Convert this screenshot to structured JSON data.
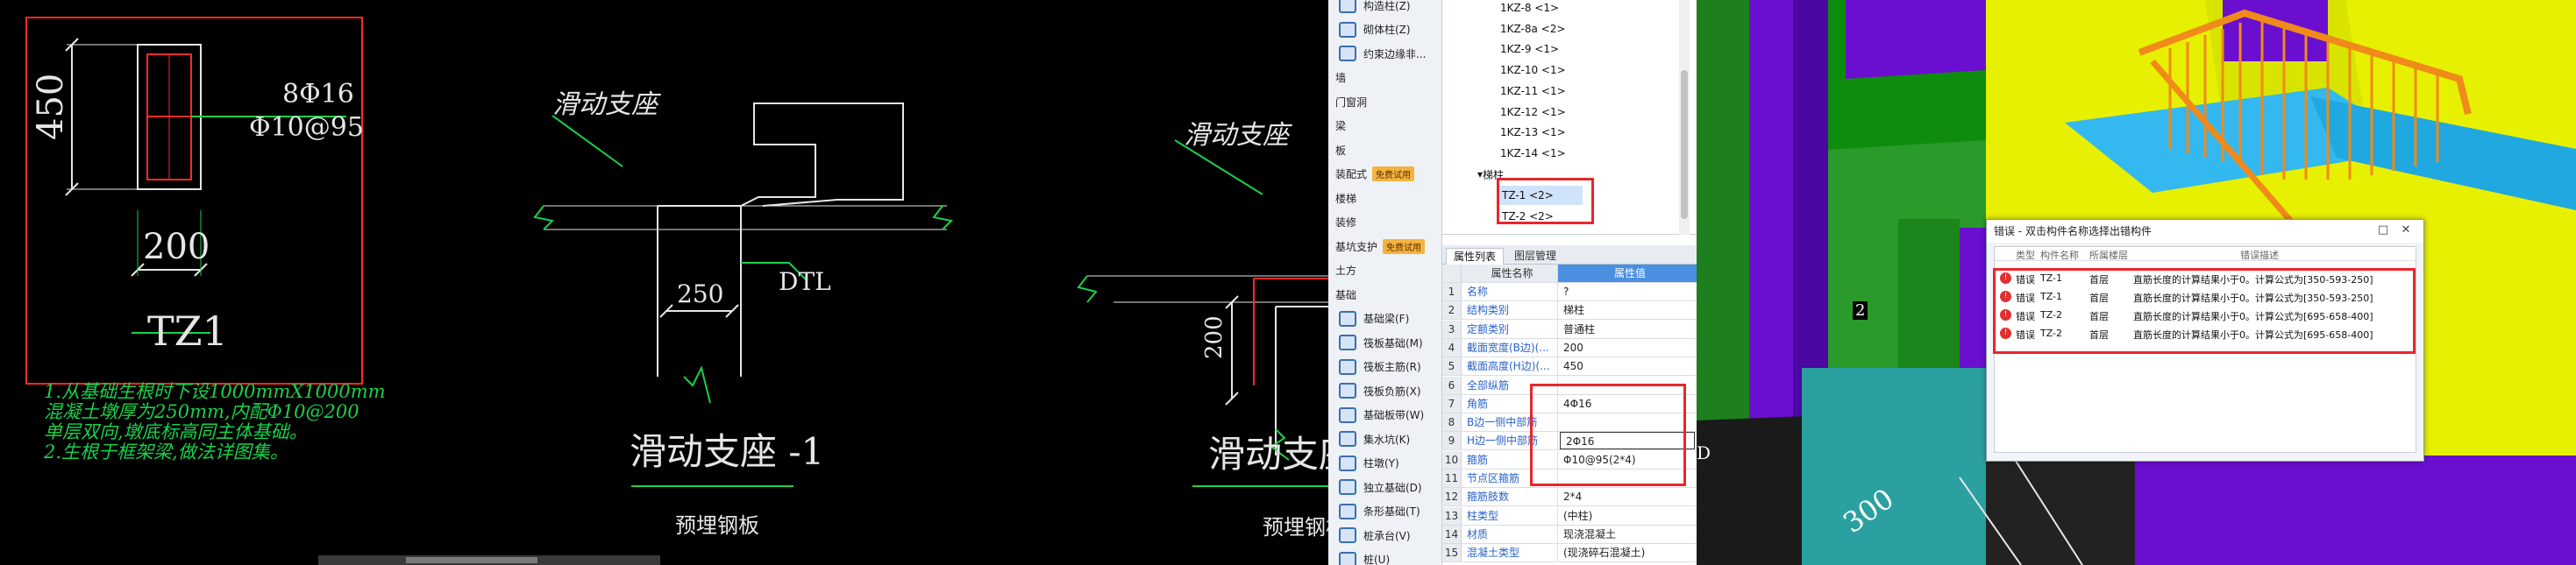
{
  "cad": {
    "tz1": {
      "height_dim": "450",
      "width_dim": "200",
      "rebar_main": "8Φ16",
      "rebar_stirrup": "Φ10@95",
      "label": "TZ1"
    },
    "notes": [
      "1.从基础生根时下设1000mmX1000mm",
      "混凝土墩厚为250mm,内配Φ10@200",
      "单层双向,墩底标高同主体基础。",
      "2.生根于框架梁,做法详图集。"
    ],
    "support1": {
      "leader": "滑动支座",
      "dim": "250",
      "dtl": "DTL",
      "title": "滑动支座  -1",
      "sub": "预埋钢板"
    },
    "support2": {
      "leader": "滑动支座",
      "dim": "200",
      "title": "滑动支座  -",
      "sub": "预埋钢板"
    }
  },
  "nav": {
    "items": [
      {
        "type": "item",
        "label": "构造柱(Z)"
      },
      {
        "type": "item",
        "label": "砌体柱(Z)"
      },
      {
        "type": "item",
        "label": "约束边缘非..."
      },
      {
        "type": "cat",
        "label": "墙"
      },
      {
        "type": "cat",
        "label": "门窗洞"
      },
      {
        "type": "cat",
        "label": "梁"
      },
      {
        "type": "cat",
        "label": "板"
      },
      {
        "type": "cat",
        "label": "装配式",
        "badge": "免费试用"
      },
      {
        "type": "cat",
        "label": "楼梯"
      },
      {
        "type": "cat",
        "label": "装修"
      },
      {
        "type": "cat",
        "label": "基坑支护",
        "badge": "免费试用"
      },
      {
        "type": "cat",
        "label": "土方"
      },
      {
        "type": "cat",
        "label": "基础"
      },
      {
        "type": "item",
        "label": "基础梁(F)"
      },
      {
        "type": "item",
        "label": "筏板基础(M)"
      },
      {
        "type": "item",
        "label": "筏板主筋(R)"
      },
      {
        "type": "item",
        "label": "筏板负筋(X)"
      },
      {
        "type": "item",
        "label": "基础板带(W)"
      },
      {
        "type": "item",
        "label": "集水坑(K)"
      },
      {
        "type": "item",
        "label": "柱墩(Y)"
      },
      {
        "type": "item",
        "label": "独立基础(D)"
      },
      {
        "type": "item",
        "label": "条形基础(T)"
      },
      {
        "type": "item",
        "label": "桩承台(V)"
      },
      {
        "type": "item",
        "label": "桩(U)"
      }
    ]
  },
  "tree": {
    "items": [
      "1KZ-8 <1>",
      "1KZ-8a <2>",
      "1KZ-9 <1>",
      "1KZ-10 <1>",
      "1KZ-11 <1>",
      "1KZ-12 <1>",
      "1KZ-13 <1>",
      "1KZ-14 <1>"
    ],
    "group": "梯柱",
    "sub_items": [
      "TZ-1 <2>",
      "TZ-2 <2>"
    ]
  },
  "tabs": [
    "属性列表",
    "图层管理"
  ],
  "props": {
    "header": {
      "name": "属性名称",
      "value": "属性值"
    },
    "rows": [
      {
        "n": "1",
        "k": "名称",
        "v": "?"
      },
      {
        "n": "2",
        "k": "结构类别",
        "v": "梯柱"
      },
      {
        "n": "3",
        "k": "定额类别",
        "v": "普通柱"
      },
      {
        "n": "4",
        "k": "截面宽度(B边)(...",
        "v": "200"
      },
      {
        "n": "5",
        "k": "截面高度(H边)(...",
        "v": "450"
      },
      {
        "n": "6",
        "k": "全部纵筋",
        "v": ""
      },
      {
        "n": "7",
        "k": "角筋",
        "v": "4Φ16"
      },
      {
        "n": "8",
        "k": "B边一侧中部筋",
        "v": ""
      },
      {
        "n": "9",
        "k": "H边一侧中部筋",
        "v": "2Φ16"
      },
      {
        "n": "10",
        "k": "箍筋",
        "v": "Φ10@95(2*4)"
      },
      {
        "n": "11",
        "k": "节点区箍筋",
        "v": ""
      },
      {
        "n": "12",
        "k": "箍筋肢数",
        "v": "2*4"
      },
      {
        "n": "13",
        "k": "柱类型",
        "v": "(中柱)"
      },
      {
        "n": "14",
        "k": "材质",
        "v": "现浇混凝土"
      },
      {
        "n": "15",
        "k": "混凝土类型",
        "v": "(现浇碎石混凝土)"
      }
    ]
  },
  "view3d": {
    "dim_300": "300",
    "marker_2": "2",
    "marker_d": "D"
  },
  "dialog": {
    "title": "错误 - 双击构件名称选择出错构件",
    "cols": [
      "类型",
      "构件名称",
      "所属楼层",
      "错误描述"
    ],
    "rows": [
      {
        "type": "错误",
        "name": "TZ-1",
        "floor": "首层",
        "desc": "直筋长度的计算结果小于0。计算公式为[350-593-250]"
      },
      {
        "type": "错误",
        "name": "TZ-1",
        "floor": "首层",
        "desc": "直筋长度的计算结果小于0。计算公式为[350-593-250]"
      },
      {
        "type": "错误",
        "name": "TZ-2",
        "floor": "首层",
        "desc": "直筋长度的计算结果小于0。计算公式为[695-658-400]"
      },
      {
        "type": "错误",
        "name": "TZ-2",
        "floor": "首层",
        "desc": "直筋长度的计算结果小于0。计算公式为[695-658-400]"
      }
    ]
  }
}
